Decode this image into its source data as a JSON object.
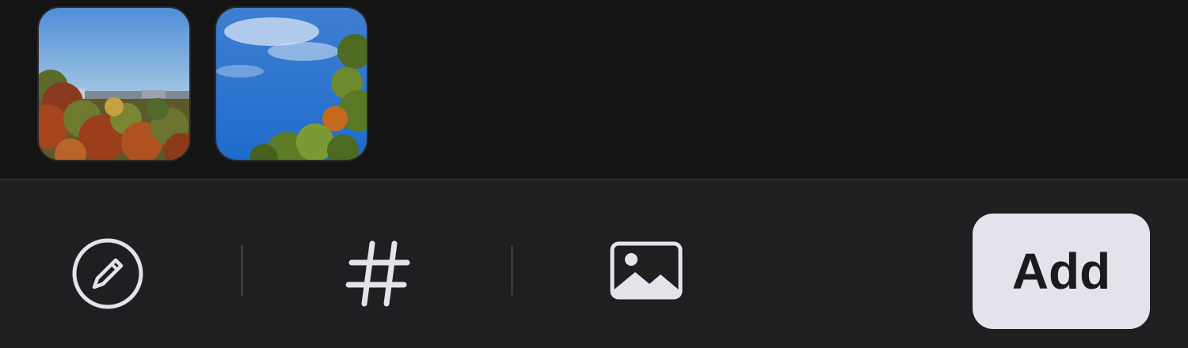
{
  "attachments": {
    "thumbnails": [
      {
        "name": "photo-autumn-trees-skyline"
      },
      {
        "name": "photo-blue-sky-tree"
      }
    ]
  },
  "toolbar": {
    "icons": [
      "pencil-icon",
      "hashtag-icon",
      "photo-icon"
    ],
    "add_label": "Add"
  },
  "colors": {
    "background": "#1f1f21",
    "attachment_area": "#141415",
    "icon": "#e4e2ea",
    "button_bg": "#e4e2ea",
    "button_text": "#1b1b1d"
  }
}
